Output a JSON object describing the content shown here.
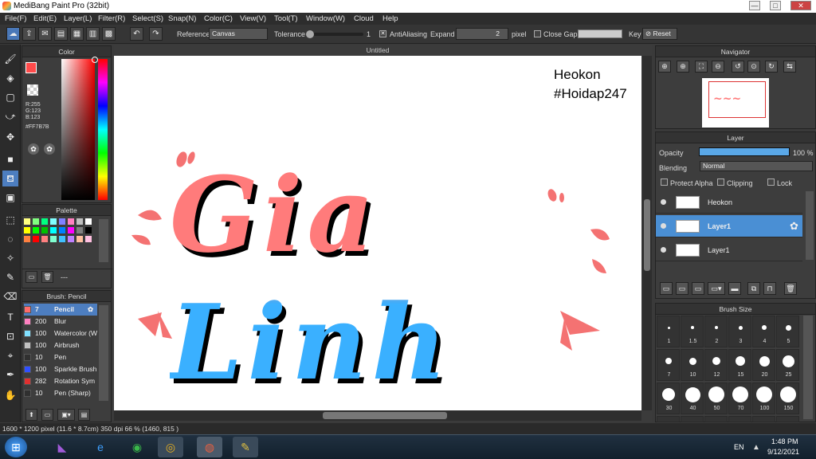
{
  "window": {
    "title": "MediBang Paint Pro (32bit)",
    "minimize": "—",
    "maximize": "□",
    "close": "✕"
  },
  "menu": [
    "File(F)",
    "Edit(E)",
    "Layer(L)",
    "Filter(R)",
    "Select(S)",
    "Snap(N)",
    "Color(C)",
    "View(V)",
    "Tool(T)",
    "Window(W)",
    "Cloud",
    "Help"
  ],
  "toolbar": {
    "reference_label": "Reference",
    "reference_value": "Canvas",
    "tolerance_label": "Tolerance",
    "tolerance_value": "1",
    "antialias_label": "AntiAliasing",
    "expand_label": "Expand",
    "expand_value": "2",
    "expand_unit": "pixel",
    "close_gaps_label": "Close Gaps",
    "key_label": "Key",
    "reset_label": "Reset"
  },
  "color_panel": {
    "title": "Color",
    "r": "R:255",
    "g": "G:123",
    "b": "B:123",
    "hex": "#FF7B7B",
    "primary_color": "#ff4b4b"
  },
  "palette": {
    "title": "Palette",
    "dash": "---",
    "colors": [
      "#ffff80",
      "#80ff80",
      "#00ff80",
      "#80ffff",
      "#8080ff",
      "#ff80c0",
      "#c0c0c0",
      "#ffffff",
      "#ffff00",
      "#00ff00",
      "#00c000",
      "#00ffff",
      "#0080ff",
      "#ff00ff",
      "#808080",
      "#000000",
      "#ff8040",
      "#ff0000",
      "#ff8080",
      "#80ffd0",
      "#40c0ff",
      "#c080ff",
      "#ffc0a0",
      "#ffc0e0"
    ]
  },
  "brush": {
    "title": "Brush: Pencil",
    "items": [
      {
        "size": "7",
        "name": "Pencil",
        "color": "#ff6b6b"
      },
      {
        "size": "200",
        "name": "Blur",
        "color": "#ff80c0"
      },
      {
        "size": "100",
        "name": "Watercolor (W",
        "color": "#80e0ff"
      },
      {
        "size": "100",
        "name": "Airbrush",
        "color": "#c0c0c0"
      },
      {
        "size": "10",
        "name": "Pen",
        "color": "#303030"
      },
      {
        "size": "100",
        "name": "Sparkle Brush",
        "color": "#3050ff"
      },
      {
        "size": "282",
        "name": "Rotation Sym",
        "color": "#e03030"
      },
      {
        "size": "10",
        "name": "Pen (Sharp)",
        "color": "#303030"
      }
    ]
  },
  "canvas": {
    "tab": "Untitled",
    "author": "Heokon",
    "tag": "#Hoidap247",
    "artwork_text": "Gia Linh"
  },
  "navigator": {
    "title": "Navigator"
  },
  "layer_panel": {
    "title": "Layer",
    "opacity_label": "Opacity",
    "opacity_value": "100 %",
    "opacity": 1.0,
    "blending_label": "Blending",
    "blending_value": "Normal",
    "protect_alpha": "Protect Alpha",
    "clipping": "Clipping",
    "lock": "Lock",
    "layers": [
      {
        "name": "Heokon",
        "selected": false
      },
      {
        "name": "Layer1",
        "selected": true
      },
      {
        "name": "Layer1",
        "selected": false
      }
    ]
  },
  "brush_size": {
    "title": "Brush Size",
    "sizes": [
      "1",
      "1.5",
      "2",
      "3",
      "4",
      "5",
      "7",
      "10",
      "12",
      "15",
      "20",
      "25",
      "30",
      "40",
      "50",
      "70",
      "100",
      "150"
    ]
  },
  "status": {
    "dimensions": "1600 * 1200 pixel",
    "physical": "(11.6 * 8.7cm)",
    "dpi": "350 dpi",
    "zoom": "66 %",
    "coords": "(1460, 815 )"
  },
  "taskbar": {
    "lang": "EN",
    "time": "1:48 PM",
    "date": "9/12/2021"
  }
}
